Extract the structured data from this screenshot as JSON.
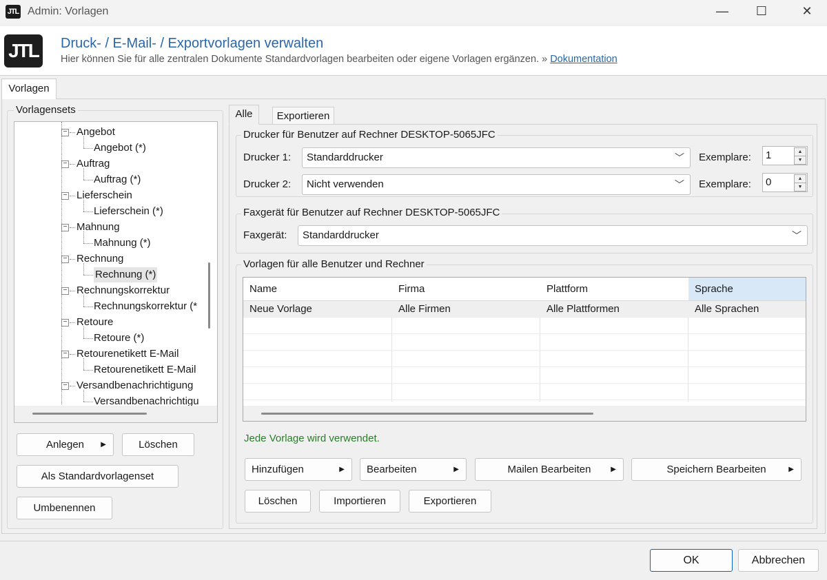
{
  "window": {
    "title": "Admin: Vorlagen",
    "app_icon_text": "JTL",
    "minimize": "—",
    "maximize": "☐",
    "close": "✕"
  },
  "header": {
    "logo_text": "JTL",
    "title": "Druck- / E-Mail- / Exportvorlagen verwalten",
    "subtitle": "Hier können Sie für alle zentralen Dokumente Standardvorlagen bearbeiten oder eigene Vorlagen ergänzen.",
    "link_prefix": "»",
    "link_label": "Dokumentation"
  },
  "main_tab": "Vorlagen",
  "left": {
    "group_label": "Vorlagensets",
    "tree": [
      {
        "label": "Angebot",
        "child": "Angebot (*)"
      },
      {
        "label": "Auftrag",
        "child": "Auftrag (*)"
      },
      {
        "label": "Lieferschein",
        "child": "Lieferschein (*)"
      },
      {
        "label": "Mahnung",
        "child": "Mahnung (*)"
      },
      {
        "label": "Rechnung",
        "child": "Rechnung (*)"
      },
      {
        "label": "Rechnungskorrektur",
        "child": "Rechnungskorrektur (*"
      },
      {
        "label": "Retoure",
        "child": "Retoure (*)"
      },
      {
        "label": "Retourenetikett E-Mail",
        "child": "Retourenetikett E-Mail"
      },
      {
        "label": "Versandbenachrichtigung",
        "child": "Versandbenachrichtigu"
      }
    ],
    "selected_child_index": 4,
    "buttons": {
      "anlegen": "Anlegen",
      "loeschen": "Löschen",
      "standard": "Als Standardvorlagenset",
      "umbenennen": "Umbenennen"
    }
  },
  "right": {
    "tabs": [
      "Alle",
      "Exportieren"
    ],
    "active_tab": "Alle",
    "printer_group": "Drucker für Benutzer  auf Rechner DESKTOP-5065JFC",
    "printer1_label": "Drucker 1:",
    "printer1_value": "Standarddrucker",
    "printer2_label": "Drucker 2:",
    "printer2_value": "Nicht verwenden",
    "copies_label": "Exemplare:",
    "copies1": "1",
    "copies2": "0",
    "fax_group": "Faxgerät für Benutzer  auf Rechner DESKTOP-5065JFC",
    "fax_label": "Faxgerät:",
    "fax_value": "Standarddrucker",
    "templates_group": "Vorlagen für alle Benutzer und Rechner",
    "grid": {
      "columns": [
        "Name",
        "Firma",
        "Plattform",
        "Sprache"
      ],
      "rows": [
        [
          "Neue Vorlage",
          "Alle Firmen",
          "Alle Plattformen",
          "Alle Sprachen"
        ]
      ]
    },
    "status": "Jede Vorlage wird verwendet.",
    "buttons": {
      "hinzufuegen": "Hinzufügen",
      "bearbeiten": "Bearbeiten",
      "mailen": "Mailen Bearbeiten",
      "speichern": "Speichern Bearbeiten",
      "loeschen": "Löschen",
      "importieren": "Importieren",
      "exportieren": "Exportieren"
    }
  },
  "footer": {
    "ok": "OK",
    "cancel": "Abbrechen"
  },
  "colors": {
    "accent": "#2a67a8",
    "status_green": "#2b7d2b",
    "ok_border": "#0a62c5"
  }
}
